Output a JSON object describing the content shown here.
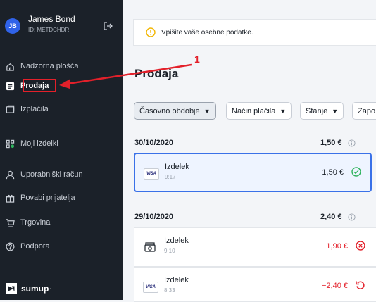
{
  "user": {
    "initials": "JB",
    "name": "James Bond",
    "id": "ID: METDCHDR"
  },
  "nav": [
    {
      "label": "Nadzorna plošča",
      "icon": "home-icon"
    },
    {
      "label": "Prodaja",
      "icon": "sales-icon",
      "active": true
    },
    {
      "label": "Izplačila",
      "icon": "payouts-icon"
    },
    {
      "label": "Moji izdelki",
      "icon": "products-icon"
    },
    {
      "label": "Uporabniški račun",
      "icon": "account-icon"
    },
    {
      "label": "Povabi prijatelja",
      "icon": "gift-icon"
    },
    {
      "label": "Trgovina",
      "icon": "cart-icon"
    },
    {
      "label": "Podpora",
      "icon": "help-icon"
    }
  ],
  "brand": "sumup",
  "brand_mark": "·",
  "banner": {
    "text": "Vpišite vaše osebne podatke."
  },
  "page_title": "Prodaja",
  "marker": "1",
  "filters": [
    {
      "label": "Časovno obdobje"
    },
    {
      "label": "Način plačila"
    },
    {
      "label": "Stanje"
    },
    {
      "label": "Zapo"
    }
  ],
  "groups": [
    {
      "date": "30/10/2020",
      "total": "1,50 €",
      "transactions": [
        {
          "name": "Izdelek",
          "time": "9:17",
          "amount": "1,50 €",
          "status": "success",
          "method": "VISA"
        }
      ]
    },
    {
      "date": "29/10/2020",
      "total": "2,40 €",
      "transactions": [
        {
          "name": "Izdelek",
          "time": "9:10",
          "amount": "1,90 €",
          "status": "failed",
          "method": "cash"
        },
        {
          "name": "Izdelek",
          "time": "8:33",
          "amount": "−2,40 €",
          "status": "refunded",
          "method": "VISA"
        }
      ]
    }
  ],
  "colors": {
    "sidebar": "#1b2129",
    "accent": "#3a71e8",
    "success": "#2fb35d",
    "error": "#e3202a",
    "warning": "#f2b705"
  }
}
